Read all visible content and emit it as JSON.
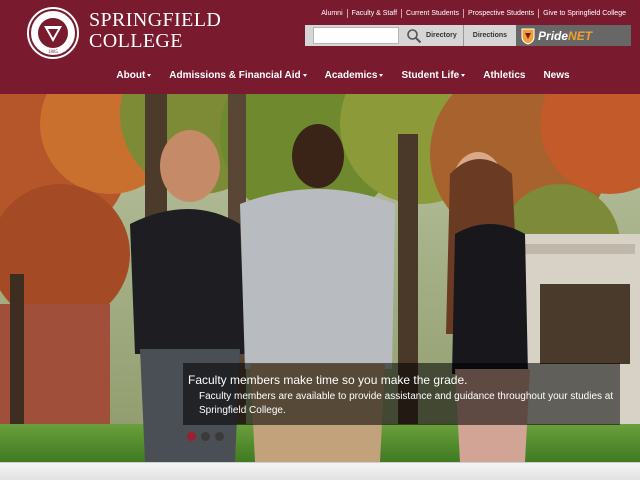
{
  "brand": {
    "name_line1": "SPRINGFIELD",
    "name_line2": "COLLEGE",
    "seal_top": "SPRINGFIELD COLLEGE",
    "seal_year": "1885",
    "color": "#7a1a2e"
  },
  "utility_nav": [
    "Alumni",
    "Faculty & Staff",
    "Current Students",
    "Prospective Students",
    "Give to Springfield College"
  ],
  "search": {
    "value": "",
    "placeholder": "",
    "icon": "search-icon"
  },
  "quick_links": {
    "directory": "Directory",
    "directions": "Directions",
    "pridenet_a": "Pride",
    "pridenet_b": "NET"
  },
  "main_nav": [
    {
      "label": "About",
      "dropdown": true
    },
    {
      "label": "Admissions & Financial Aid",
      "dropdown": true
    },
    {
      "label": "Academics",
      "dropdown": true
    },
    {
      "label": "Student Life",
      "dropdown": true
    },
    {
      "label": "Athletics",
      "dropdown": false
    },
    {
      "label": "News",
      "dropdown": false
    }
  ],
  "hero": {
    "title": "Faculty members make time so you make the grade.",
    "body": "Faculty members are available to provide assistance and guidance throughout your studies at Springfield College.",
    "slides": 3,
    "active_slide": 1
  }
}
